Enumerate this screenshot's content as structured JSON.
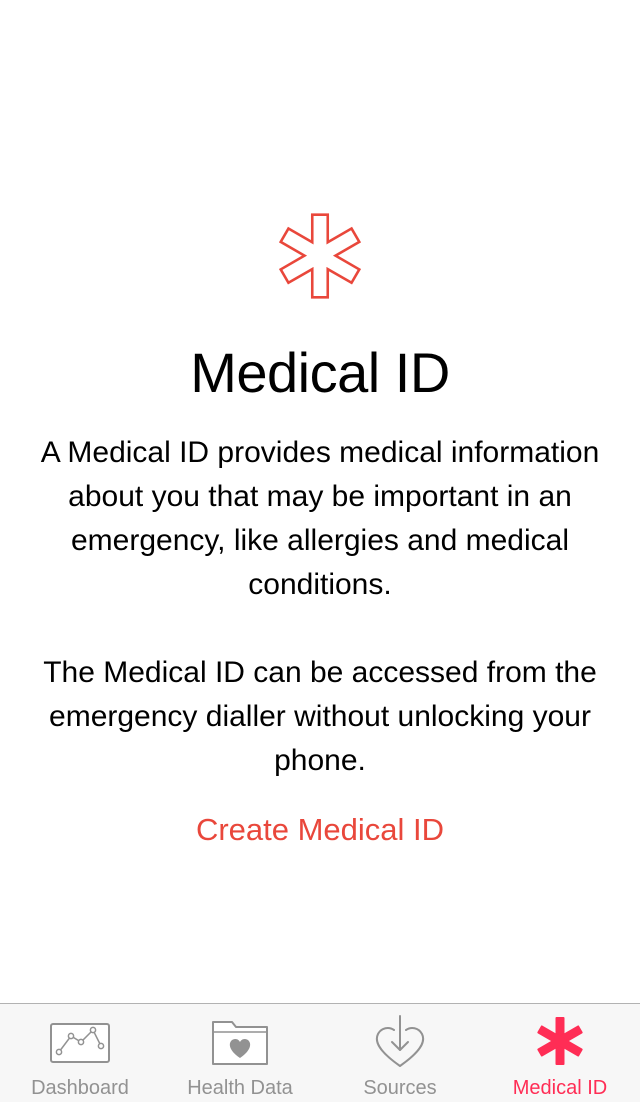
{
  "main": {
    "title": "Medical ID",
    "description_1": "A Medical ID provides medical information about you that may be important in an emergency, like allergies and medical conditions.",
    "description_2": "The Medical ID can be accessed from the emergency dialler without unlocking your phone.",
    "create_label": "Create Medical ID",
    "icon": "medical-star-outline-icon"
  },
  "tab_bar": {
    "tabs": [
      {
        "label": "Dashboard",
        "icon": "dashboard-chart-icon",
        "active": false
      },
      {
        "label": "Health Data",
        "icon": "health-data-folder-icon",
        "active": false
      },
      {
        "label": "Sources",
        "icon": "sources-heart-arrow-icon",
        "active": false
      },
      {
        "label": "Medical ID",
        "icon": "medical-star-icon",
        "active": true
      }
    ]
  },
  "colors": {
    "accent_red": "#e9473b",
    "active_tab": "#ff2d55",
    "inactive_tab": "#929292",
    "tab_bar_bg": "#f7f7f7"
  }
}
